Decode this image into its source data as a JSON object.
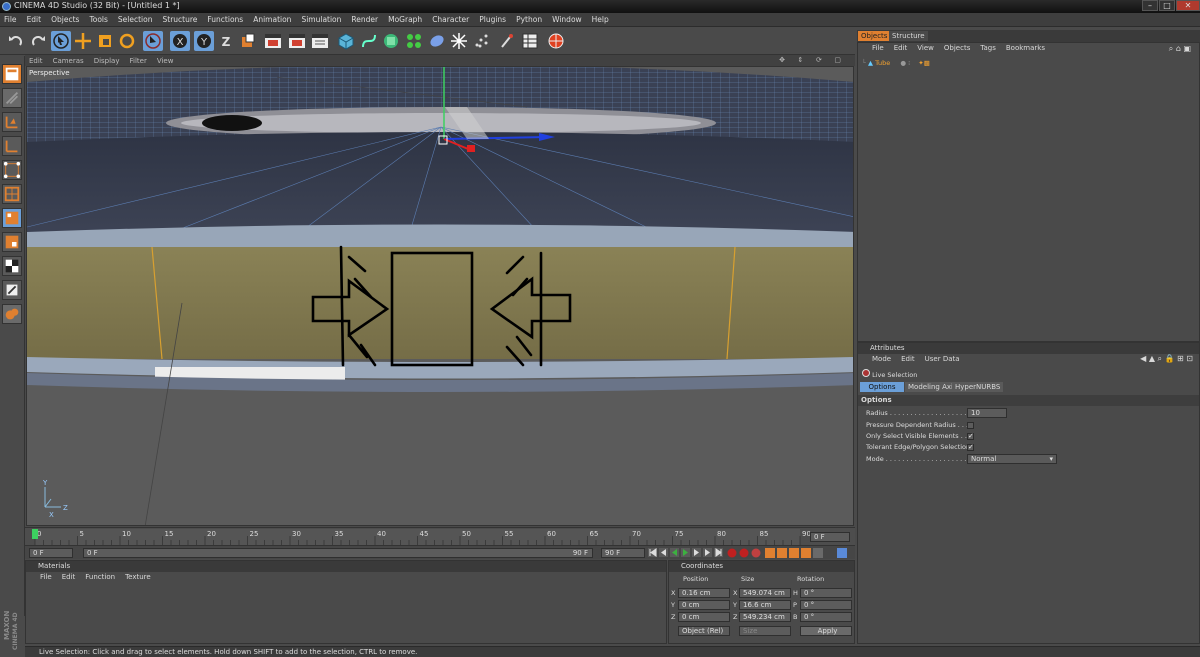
{
  "window": {
    "title": "CINEMA 4D Studio (32 Bit) - [Untitled 1 *]"
  },
  "menu": [
    "File",
    "Edit",
    "Objects",
    "Tools",
    "Selection",
    "Structure",
    "Functions",
    "Animation",
    "Simulation",
    "Render",
    "MoGraph",
    "Character",
    "Plugins",
    "Python",
    "Window",
    "Help"
  ],
  "viewport": {
    "menu": [
      "Edit",
      "Cameras",
      "Display",
      "Filter",
      "View"
    ],
    "label": "Perspective"
  },
  "timeline": {
    "ticks": [
      "0",
      "5",
      "10",
      "15",
      "20",
      "25",
      "30",
      "35",
      "40",
      "45",
      "50",
      "55",
      "60",
      "65",
      "70",
      "75",
      "80",
      "85",
      "90"
    ],
    "current": "0 F",
    "start": "0 F",
    "range_start": "0 F",
    "range_end": "90 F",
    "end": "90 F"
  },
  "materials": {
    "title": "Materials",
    "menu": [
      "File",
      "Edit",
      "Function",
      "Texture"
    ]
  },
  "coordinates": {
    "title": "Coordinates",
    "headers": [
      "Position",
      "Size",
      "Rotation"
    ],
    "rows": [
      {
        "axis": "X",
        "pos": "0.16 cm",
        "size_axis": "X",
        "size": "549.074 cm",
        "rot_axis": "H",
        "rot": "0 °"
      },
      {
        "axis": "Y",
        "pos": "0 cm",
        "size_axis": "Y",
        "size": "16.6 cm",
        "rot_axis": "P",
        "rot": "0 °"
      },
      {
        "axis": "Z",
        "pos": "0 cm",
        "size_axis": "Z",
        "size": "549.234 cm",
        "rot_axis": "B",
        "rot": "0 °"
      }
    ],
    "mode": "Object (Rel)",
    "size_mode": "Size",
    "apply": "Apply"
  },
  "objects": {
    "tabs": [
      "Objects",
      "Structure"
    ],
    "menu": [
      "File",
      "Edit",
      "View",
      "Objects",
      "Tags",
      "Bookmarks"
    ],
    "items": [
      {
        "name": "Tube"
      }
    ]
  },
  "attributes": {
    "title": "Attributes",
    "menu": [
      "Mode",
      "Edit",
      "User Data"
    ],
    "tool": "Live Selection",
    "tabs": [
      "Options",
      "Modeling Axis",
      "HyperNURBS"
    ],
    "section": "Options",
    "fields": {
      "radius_label": "Radius . . . . . . . . . . . . . . . . . . .",
      "radius_value": "10",
      "pressure_label": "Pressure Dependent Radius . . .",
      "visible_label": "Only Select Visible Elements . . .",
      "tolerant_label": "Tolerant Edge/Polygon Selection",
      "mode_label": "Mode . . . . . . . . . . . . . . . . . . . .",
      "mode_value": "Normal"
    }
  },
  "status": {
    "text": "Live Selection: Click and drag to select elements. Hold down SHIFT to add to the selection, CTRL to remove."
  },
  "branding": {
    "maxon": "MAXON",
    "product": "CINEMA 4D"
  },
  "colors": {
    "accent": "#e0a030",
    "selection_blue": "#6b9fd8",
    "viewport_bg": "#5a5a5a",
    "panel_bg": "#4a4a4a"
  }
}
